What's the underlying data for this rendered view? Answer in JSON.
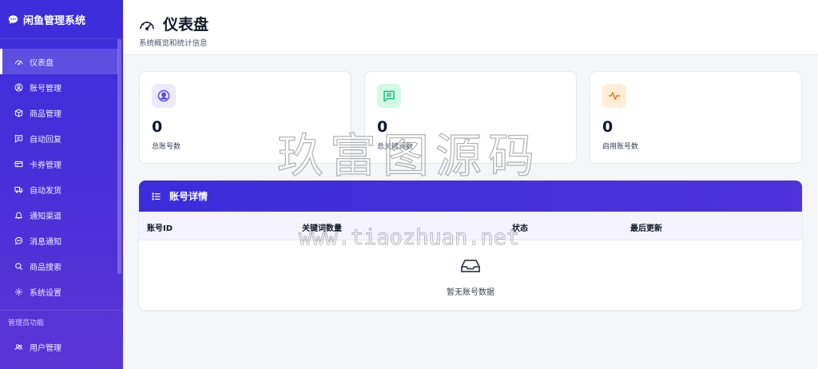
{
  "app": {
    "name": "闲鱼管理系统"
  },
  "sidebar": {
    "items": [
      {
        "label": "仪表盘"
      },
      {
        "label": "账号管理"
      },
      {
        "label": "商品管理"
      },
      {
        "label": "自动回复"
      },
      {
        "label": "卡券管理"
      },
      {
        "label": "自动发货"
      },
      {
        "label": "通知渠道"
      },
      {
        "label": "消息通知"
      },
      {
        "label": "商品搜索"
      },
      {
        "label": "系统设置"
      }
    ],
    "admin_section": "管理员功能",
    "admin_items": [
      {
        "label": "用户管理"
      }
    ]
  },
  "header": {
    "title": "仪表盘",
    "subtitle": "系统概览和统计信息"
  },
  "stats": [
    {
      "value": "0",
      "label": "总账号数",
      "icon": "user-circle-icon",
      "color": "#6d5dfc",
      "bg": "#ede9fe"
    },
    {
      "value": "0",
      "label": "总关键词数",
      "icon": "chat-icon",
      "color": "#10b981",
      "bg": "#d1fae5"
    },
    {
      "value": "0",
      "label": "启用账号数",
      "icon": "pulse-icon",
      "color": "#f97316",
      "bg": "#ffedd5"
    }
  ],
  "panel": {
    "title": "账号详情",
    "columns": [
      "账号ID",
      "关键词数量",
      "状态",
      "最后更新"
    ],
    "empty_text": "暂无账号数据"
  },
  "watermark": {
    "line1": "玖富图源码",
    "line2": "www.tiaozhuan.net"
  }
}
